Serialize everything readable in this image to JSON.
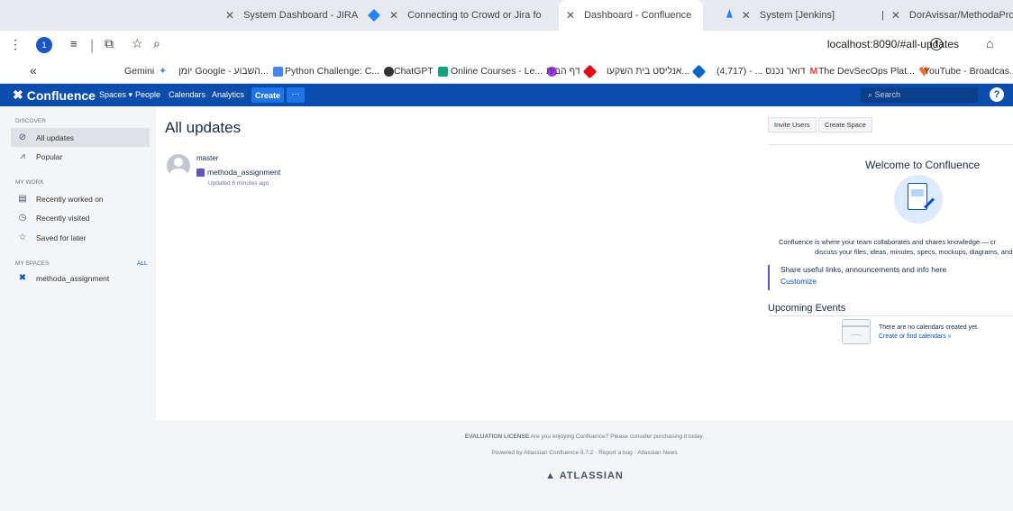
{
  "browser": {
    "tabs": [
      {
        "label": "System Dashboard - JIRA",
        "fav": "#2684ff"
      },
      {
        "label": "Connecting to Crowd or Jira fo",
        "fav": "#2684ff"
      },
      {
        "label": "Dashboard - Confluence",
        "fav": "#2684ff"
      },
      {
        "label": "System [Jenkins]",
        "fav": "#d33833"
      },
      {
        "label": "DorAvissar/MethodaProject",
        "fav": "#333333"
      }
    ],
    "url": "localhost:8090/#all-updates",
    "bookmarks": [
      {
        "label": "Gemini",
        "color": "#4285f4"
      },
      {
        "label": "יומן Google - השבוע...",
        "color": "#4285f4"
      },
      {
        "label": "Python Challenge: C...",
        "color": "#333333"
      },
      {
        "label": "ChatGPT",
        "color": "#10a37f"
      },
      {
        "label": "Online Courses - Le...",
        "color": "#a435f0"
      },
      {
        "label": "דף הבית",
        "color": "#e50914"
      },
      {
        "label": "אנליסט בית השקעו...",
        "color": "#0a66c2"
      },
      {
        "label": "(4,717) - ... דואר נכנס",
        "color": "#ea4335"
      },
      {
        "label": "The DevSecOps Plat...",
        "color": "#fc6d26"
      },
      {
        "label": "YouTube - Broadcas...",
        "color": "#ff0000"
      }
    ]
  },
  "header": {
    "app_name": "Confluence",
    "nav": [
      "Spaces ▾",
      "People",
      "Calendars",
      "Analytics"
    ],
    "create_label": "Create",
    "more_label": "···",
    "search_placeholder": "Search",
    "help_label": "?"
  },
  "sidebar": {
    "discover_title": "DISCOVER",
    "discover_items": [
      "All updates",
      "Popular"
    ],
    "mywork_title": "MY WORK",
    "mywork_items": [
      "Recently worked on",
      "Recently visited",
      "Saved for later"
    ],
    "myspaces_title": "MY SPACES",
    "myspaces_all": "ALL",
    "spaces": [
      "methoda_assignment"
    ]
  },
  "main": {
    "title": "All updates",
    "update": {
      "user": "master",
      "space": "methoda_assignment",
      "time": "Updated 6 minutes ago"
    }
  },
  "right": {
    "invite_label": "Invite Users",
    "create_space_label": "Create Space",
    "welcome_title": "Welcome to Confluence",
    "welcome_line1": "Confluence is where your team collaborates and shares knowledge — cr",
    "welcome_line2": "discuss your files, ideas, minutes, specs, mockups, diagrams, and",
    "share_text": "Share useful links, announcements and info here",
    "customize_label": "Customize",
    "events_title": "Upcoming Events",
    "no_calendars": "There are no calendars created yet.",
    "create_calendar_link": "Create or find calendars »"
  },
  "footer": {
    "license_bold": "EVALUATION LICENSE",
    "license_text": "Are you enjoying Confluence? Please consider purchasing it today.",
    "powered": "Powered by Atlassian Confluence 8.7.2",
    "report_bug": "Report a bug",
    "news": "Atlassian News",
    "brand": "ATLASSIAN"
  }
}
